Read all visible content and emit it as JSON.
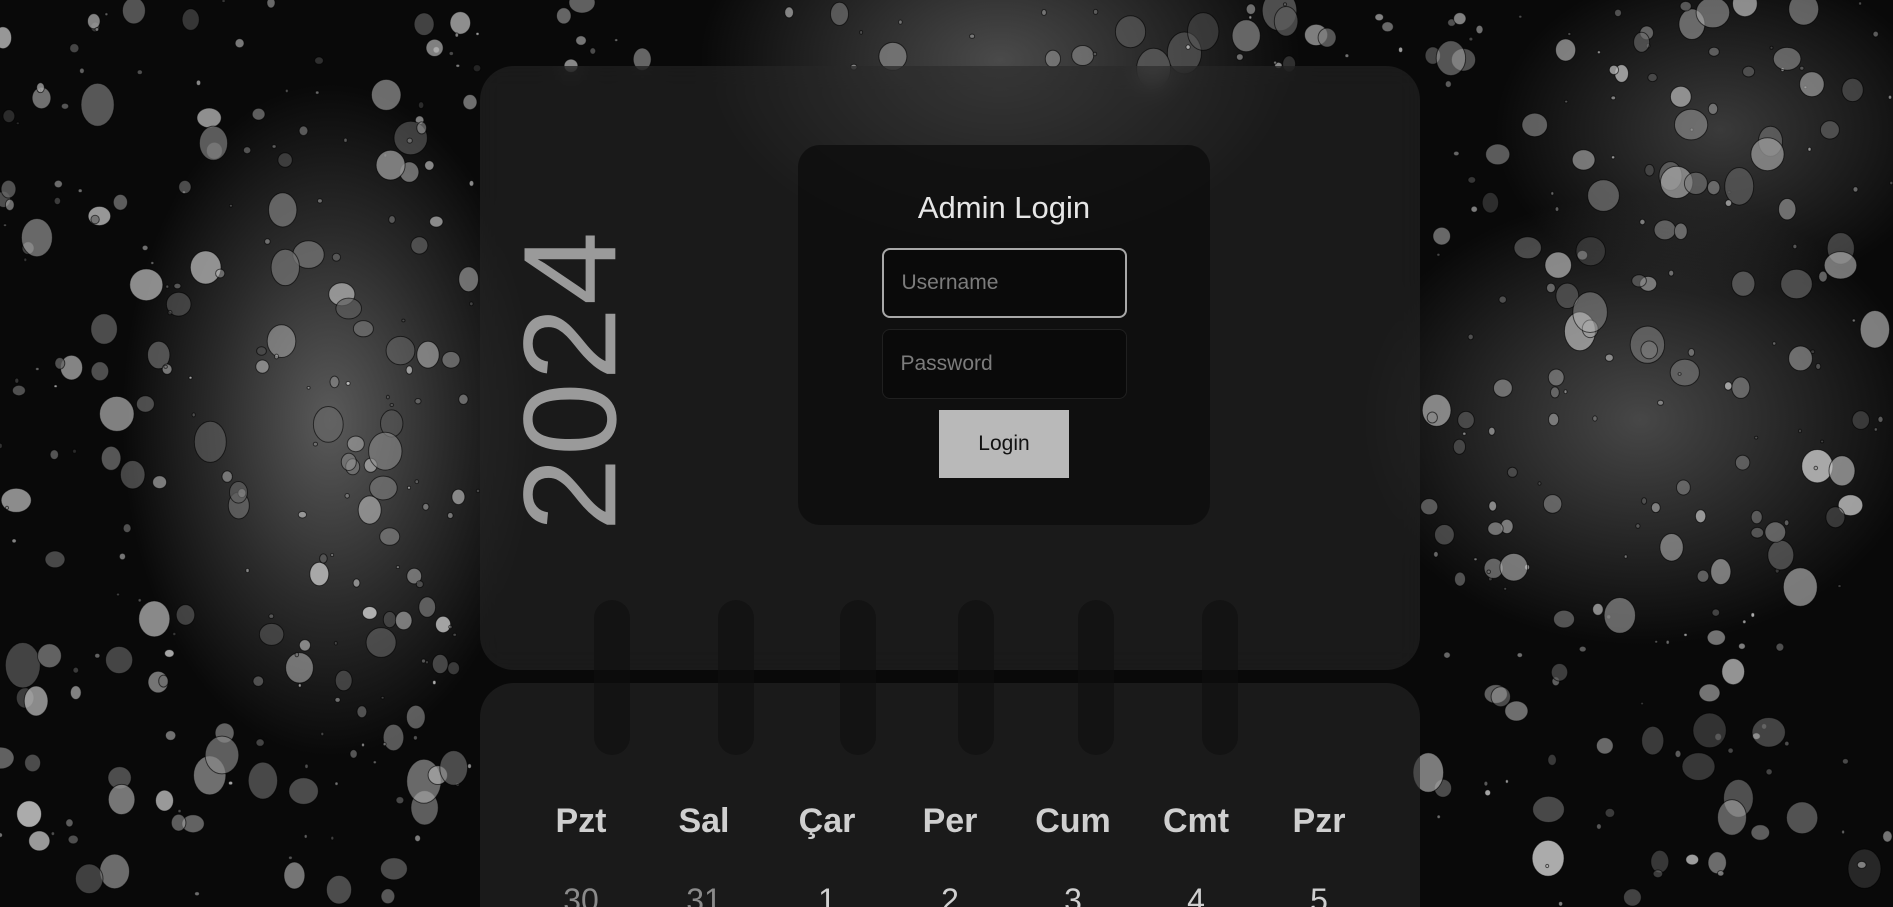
{
  "calendar": {
    "year": "2024",
    "weekdays": [
      "Pzt",
      "Sal",
      "Çar",
      "Per",
      "Cum",
      "Cmt",
      "Pzr"
    ],
    "days": [
      "30",
      "31",
      "1",
      "2",
      "3",
      "4",
      "5"
    ]
  },
  "login": {
    "title": "Admin Login",
    "username_placeholder": "Username",
    "username_value": "",
    "password_placeholder": "Password",
    "password_value": "",
    "button_label": "Login"
  },
  "colors": {
    "button_bg": "#b9b9b9",
    "text_primary": "#e6e6e6",
    "year_text": "#9a9a9a"
  }
}
